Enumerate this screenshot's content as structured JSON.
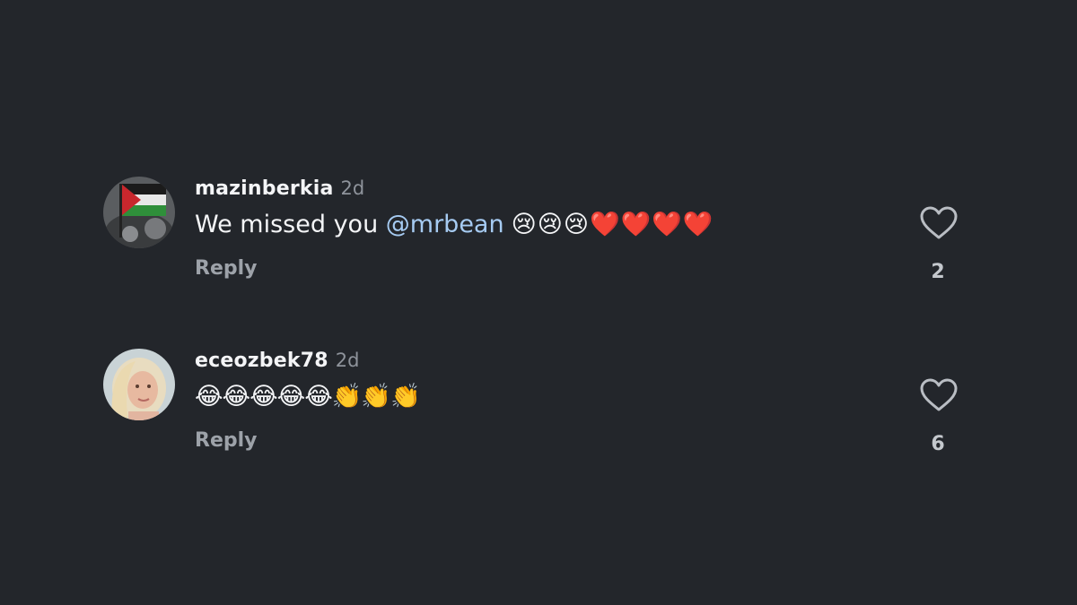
{
  "comments": [
    {
      "username": "mazinberkia",
      "time": "2d",
      "text": "We missed you",
      "mention": "@mrbean",
      "emojis": "😢😢😢❤️❤️❤️❤️",
      "reply_label": "Reply",
      "like_count": "2",
      "avatar_icon": "flag-avatar"
    },
    {
      "username": "eceozbek78",
      "time": "2d",
      "text": "",
      "emojis": "😂😂😂😂😂👏👏👏",
      "reply_label": "Reply",
      "like_count": "6",
      "avatar_icon": "portrait-avatar"
    }
  ],
  "icons": {
    "like": "heart-outline-icon"
  },
  "colors": {
    "background": "#23262b",
    "mention": "#a6cbf2",
    "secondary_text": "#9da2a9"
  }
}
